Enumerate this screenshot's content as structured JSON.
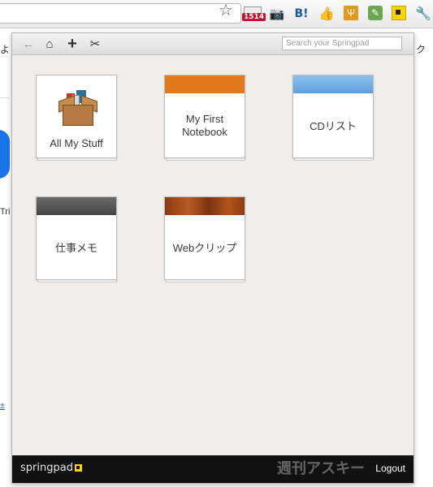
{
  "browser": {
    "toolbar_icons": [
      "star-icon",
      "mail-icon",
      "camera-icon",
      "hatena-bookmark-icon",
      "like-icon",
      "fork-icon",
      "evernote-icon",
      "springpad-icon",
      "wrench-icon"
    ],
    "mail_badge": "1514",
    "hatena_label": "B!"
  },
  "background_page": {
    "left_char": "よ",
    "right_char": "ク",
    "tri_text": "Tri",
    "link_text": "±"
  },
  "popup": {
    "search": {
      "placeholder": "Search your Springpad"
    },
    "toolbar": [
      "back-icon",
      "home-icon",
      "add-icon",
      "clip-icon"
    ],
    "notebooks": [
      {
        "label": "All My Stuff",
        "cover": "box"
      },
      {
        "label": "My First Notebook",
        "cover": "#e07a1c"
      },
      {
        "label": "CDリスト",
        "cover": "#6aa9e4"
      },
      {
        "label": "仕事メモ",
        "cover": "#555555"
      },
      {
        "label": "Webクリップ",
        "cover": "wood"
      }
    ],
    "footer": {
      "brand": "springpad",
      "logout": "Logout",
      "watermark": "週刊アスキー"
    }
  }
}
